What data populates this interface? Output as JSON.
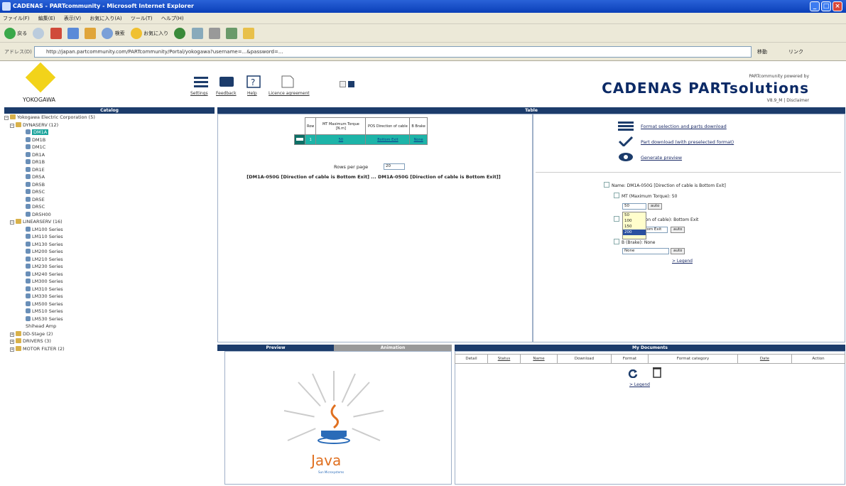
{
  "window": {
    "title": "CADENAS - PARTcommunity - Microsoft Internet Explorer",
    "buttons": [
      "_",
      "□",
      "×"
    ]
  },
  "menu": [
    "ファイル(F)",
    "編集(E)",
    "表示(V)",
    "お気に入り(A)",
    "ツール(T)",
    "ヘルプ(H)"
  ],
  "toolbar": {
    "back": "戻る",
    "search": "検索",
    "favorites": "お気に入り"
  },
  "address": {
    "label": "アドレス(D)",
    "url": "http://japan.partcommunity.com/PARTcommunity/Portal/yokogawa?username=...&password=...",
    "go": "移動",
    "links": "リンク"
  },
  "header": {
    "brand": "YOKOGAWA",
    "tools": [
      "Settings",
      "Feedback",
      "Help",
      "Licence agreement"
    ],
    "powered_by": "PARTcommunity powered by",
    "cadenas": "CADENAS PARTsolutions",
    "sub": "V8.9_M | Disclaimer"
  },
  "catalog": {
    "title": "Catalog",
    "root": "Yokogawa Electric Corporation (5)",
    "group1": {
      "label": "DYNASERV (12)",
      "items": [
        "DM1A",
        "DM1B",
        "DM1C",
        "DR1A",
        "DR1B",
        "DR1E",
        "DR5A",
        "DR5B",
        "DR5C",
        "DR5E",
        "DR5C",
        "DR5H00"
      ]
    },
    "group2": {
      "label": "LINEARSERV (16)",
      "items": [
        "LM100 Series",
        "LM110 Series",
        "LM130 Series",
        "LM200 Series",
        "LM210 Series",
        "LM230 Series",
        "LM240 Series",
        "LM300 Series",
        "LM310 Series",
        "LM330 Series",
        "LM500 Series",
        "LM510 Series",
        "LM530 Series",
        "Shihead Amp"
      ]
    },
    "group3": "DD-Stage (2)",
    "group4": "DRIVERS (3)",
    "group5": "MOTOR FILTER (2)"
  },
  "table_panel": {
    "title": "Table",
    "columns": [
      "Row",
      "MT Maximum Torque [N.m]",
      "POS Direction of cable",
      "B Brake"
    ],
    "row": [
      "1",
      "50",
      "Bottom Exit",
      "None"
    ],
    "rows_per_page_label": "Rows per page",
    "rows_per_page_value": "20",
    "description": "[DM1A-050G [Direction of cable is Bottom Exit] ... DM1A-050G [Direction of cable is Bottom Exit]]"
  },
  "actions": {
    "format_selection": "Format selection and parts download",
    "part_download": "Part download (with preselected format)",
    "generate_preview": "Generate preview"
  },
  "params": {
    "name": "Name: DM1A-050G [Direction of cable is Bottom Exit]",
    "mt_label": "MT (Maximum Torque): 50",
    "mt_value": "50",
    "pos_label": "Direction of cable): Bottom Exit",
    "pos_value": "Bottom Exit",
    "brake_label": "B (Brake): None",
    "brake_value": "None",
    "apply": "auto",
    "legend": "> Legend",
    "dropdown_options": [
      "50",
      "100",
      "150",
      "200"
    ],
    "dropdown_highlight": "200"
  },
  "preview": {
    "title": "Preview",
    "tab2": "Animation",
    "java_text": "Java",
    "java_sub": "Sun Microsystems"
  },
  "docs": {
    "title": "My Documents",
    "columns": [
      "Detail",
      "Status",
      "Name",
      "Download",
      "Format",
      "Format category",
      "Date",
      "Action"
    ],
    "legend": "> Legend"
  },
  "colors": {
    "header_blue": "#1c3c6b",
    "teal": "#1db4a8",
    "yellow": "#f2d31a"
  }
}
